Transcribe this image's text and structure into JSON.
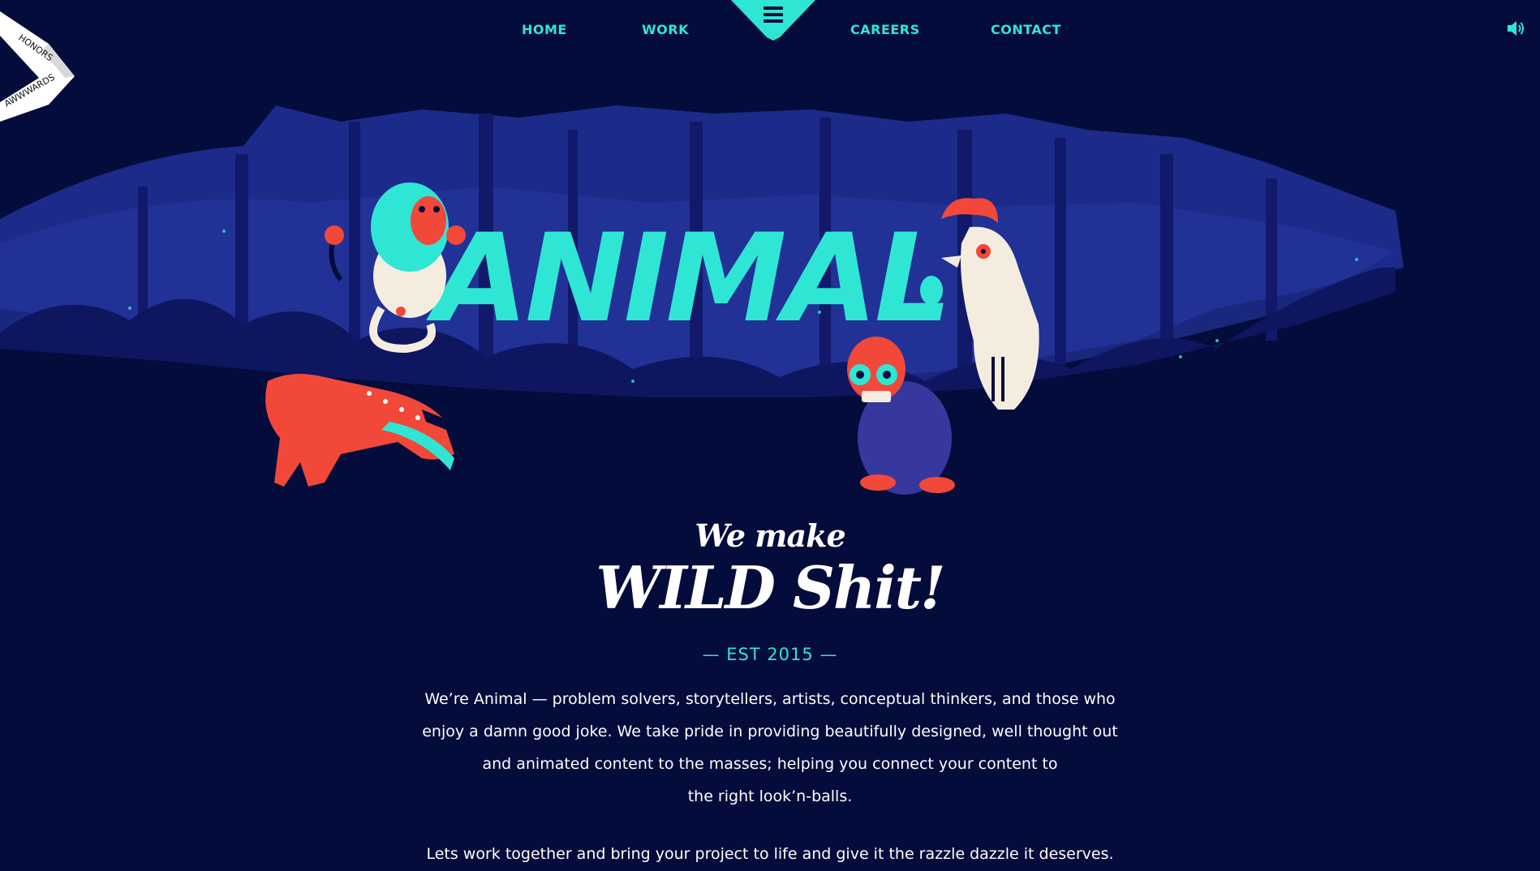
{
  "nav": {
    "home": "HOME",
    "work": "WORK",
    "careers": "CAREERS",
    "contact": "CONTACT",
    "menu_icon": "hamburger-icon",
    "sound_icon": "speaker-icon"
  },
  "badge": {
    "top": "HONORS",
    "bottom": "AWWWARDS"
  },
  "hero": {
    "logo": "ANIMAL",
    "tagline_small": "We make",
    "tagline_big": "WILD Shit!"
  },
  "est": "— EST 2015 —",
  "intro": {
    "line1": "We’re Animal — problem solvers, storytellers, artists, conceptual thinkers, and those who",
    "line2": "enjoy a damn good joke. We take pride in providing beautifully designed, well thought out",
    "line3": "and animated content to the masses; helping you connect your content to",
    "line4": "the right look’n-balls."
  },
  "cta": "Lets work together and bring your project to life and give it the razzle dazzle it deserves.",
  "colors": {
    "background": "#030c3a",
    "accent": "#2fe6d5",
    "forest": "#1c2a8a",
    "red": "#f2483a"
  }
}
